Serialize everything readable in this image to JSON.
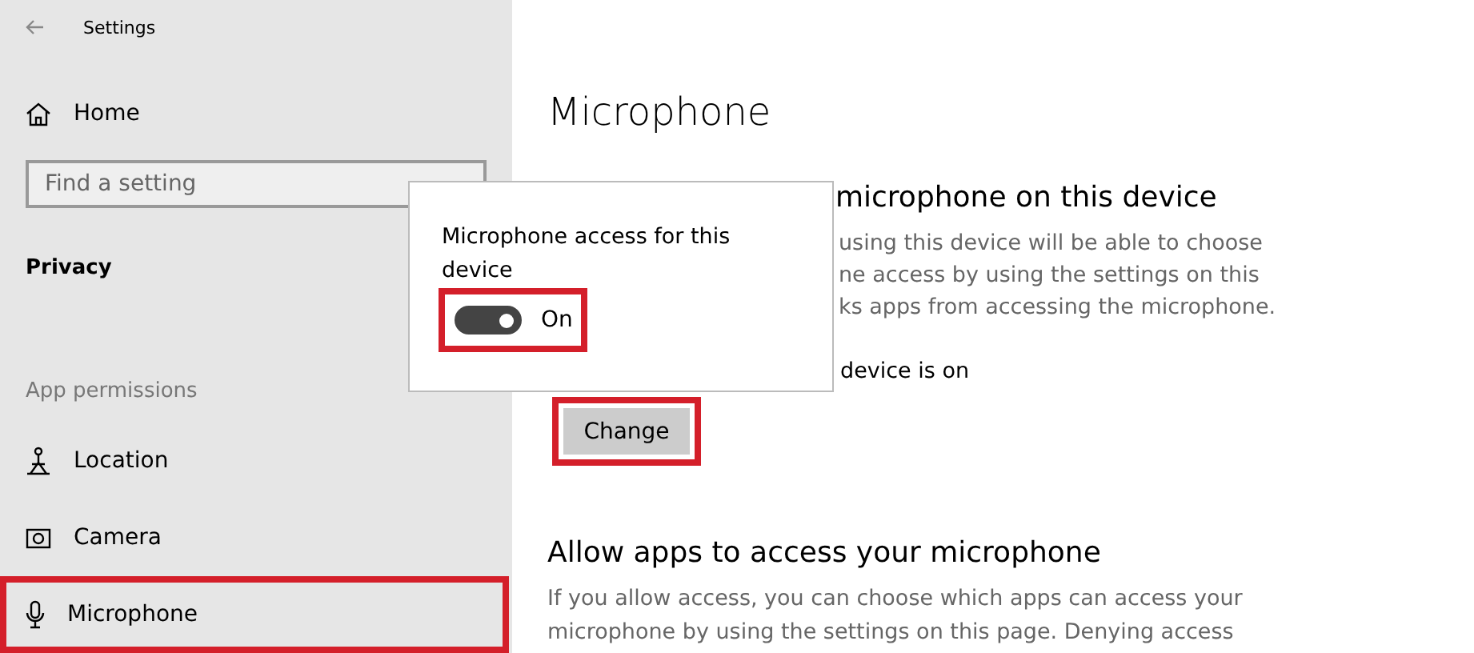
{
  "window": {
    "title": "Settings"
  },
  "sidebar": {
    "home": "Home",
    "search": {
      "placeholder": "Find a setting"
    },
    "section": "Privacy",
    "group": "App permissions",
    "items": [
      {
        "label": "Location",
        "highlighted": false
      },
      {
        "label": "Camera",
        "highlighted": false
      },
      {
        "label": "Microphone",
        "highlighted": true
      }
    ]
  },
  "content": {
    "title": "Microphone",
    "section1": {
      "heading": "microphone on this device",
      "lines": [
        "using this device will be able to choose",
        "ne access by using the settings on this",
        "ks apps from accessing the microphone."
      ],
      "status": "device is on",
      "button": {
        "label": "Change",
        "highlighted": true
      }
    },
    "section2": {
      "heading": "Allow apps to access your microphone",
      "text": "If you allow access, you can choose which apps can access your microphone by using the settings on this page. Denying access"
    }
  },
  "popup": {
    "label": "Microphone access for this device",
    "toggle": {
      "on": true,
      "label": "On",
      "highlighted": true
    }
  }
}
